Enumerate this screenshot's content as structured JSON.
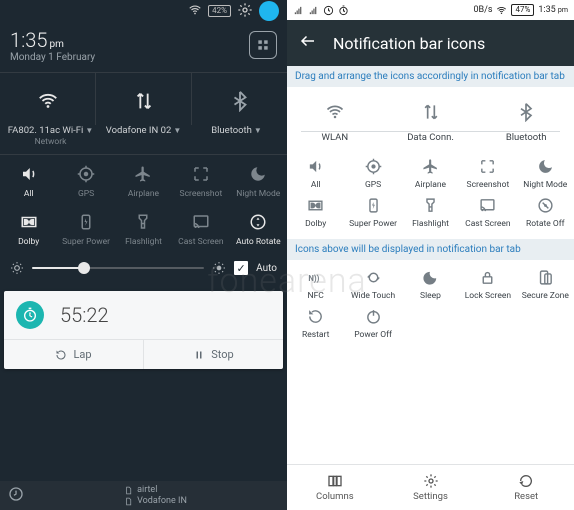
{
  "left": {
    "status": {
      "wifi_icon": "wifi",
      "battery_pct": "42%"
    },
    "time": {
      "clock": "1:35",
      "ampm": "pm",
      "date": "Monday 1 February"
    },
    "qs_top": [
      {
        "icon": "wifi",
        "label": "FA802. 11ac Wi-Fi",
        "sublabel": "Network",
        "on": true
      },
      {
        "icon": "data",
        "label": "Vodafone IN 02",
        "sublabel": "",
        "on": true
      },
      {
        "icon": "bluetooth",
        "label": "Bluetooth",
        "sublabel": "",
        "on": false
      }
    ],
    "tiles_row1": [
      {
        "icon": "volume",
        "label": "All",
        "on": true
      },
      {
        "icon": "gps",
        "label": "GPS",
        "on": false
      },
      {
        "icon": "airplane",
        "label": "Airplane",
        "on": false
      },
      {
        "icon": "screenshot",
        "label": "Screenshot",
        "on": false
      },
      {
        "icon": "night",
        "label": "Night Mode",
        "on": false
      }
    ],
    "tiles_row2": [
      {
        "icon": "dolby",
        "label": "Dolby",
        "on": true
      },
      {
        "icon": "superpower",
        "label": "Super Power",
        "on": false
      },
      {
        "icon": "flashlight",
        "label": "Flashlight",
        "on": false
      },
      {
        "icon": "cast",
        "label": "Cast Screen",
        "on": false
      },
      {
        "icon": "autorotate",
        "label": "Auto Rotate",
        "on": true
      }
    ],
    "brightness": {
      "auto_label": "Auto",
      "auto_checked": true,
      "value_pct": 30
    },
    "stopwatch": {
      "time": "55:22",
      "lap_label": "Lap",
      "stop_label": "Stop"
    },
    "footer": {
      "sim1": "airtel",
      "sim2": "Vodafone IN"
    },
    "header_icons": {
      "settings": "gear",
      "profile": "avatar",
      "profile_color": "#1fb6ef"
    }
  },
  "right": {
    "status": {
      "net_label": "0B/s",
      "battery_pct": "47%",
      "clock": "1:35",
      "ampm": "pm"
    },
    "title": "Notification bar icons",
    "band1": "Drag and arrange the icons accordingly in notification bar tab",
    "top3": [
      {
        "icon": "wifi",
        "label": "WLAN"
      },
      {
        "icon": "data",
        "label": "Data Conn."
      },
      {
        "icon": "bluetooth",
        "label": "Bluetooth"
      }
    ],
    "grid1": [
      {
        "icon": "volume",
        "label": "All"
      },
      {
        "icon": "gps",
        "label": "GPS"
      },
      {
        "icon": "airplane",
        "label": "Airplane"
      },
      {
        "icon": "screenshot",
        "label": "Screenshot"
      },
      {
        "icon": "night",
        "label": "Night Mode"
      },
      {
        "icon": "dolby",
        "label": "Dolby"
      },
      {
        "icon": "superpower",
        "label": "Super Power"
      },
      {
        "icon": "flashlight",
        "label": "Flashlight"
      },
      {
        "icon": "cast",
        "label": "Cast Screen"
      },
      {
        "icon": "rotateoff",
        "label": "Rotate Off"
      }
    ],
    "band2": "Icons above will be displayed in notification bar tab",
    "grid2": [
      {
        "icon": "nfc",
        "label": "NFC"
      },
      {
        "icon": "widetouch",
        "label": "Wide Touch"
      },
      {
        "icon": "sleep",
        "label": "Sleep"
      },
      {
        "icon": "lock",
        "label": "Lock Screen"
      },
      {
        "icon": "securezone",
        "label": "Secure Zone"
      },
      {
        "icon": "restart",
        "label": "Restart"
      },
      {
        "icon": "poweroff",
        "label": "Power Off"
      }
    ],
    "footer": [
      {
        "icon": "columns",
        "label": "Columns"
      },
      {
        "icon": "settings",
        "label": "Settings"
      },
      {
        "icon": "reset",
        "label": "Reset"
      }
    ]
  },
  "watermark": "fonearena"
}
